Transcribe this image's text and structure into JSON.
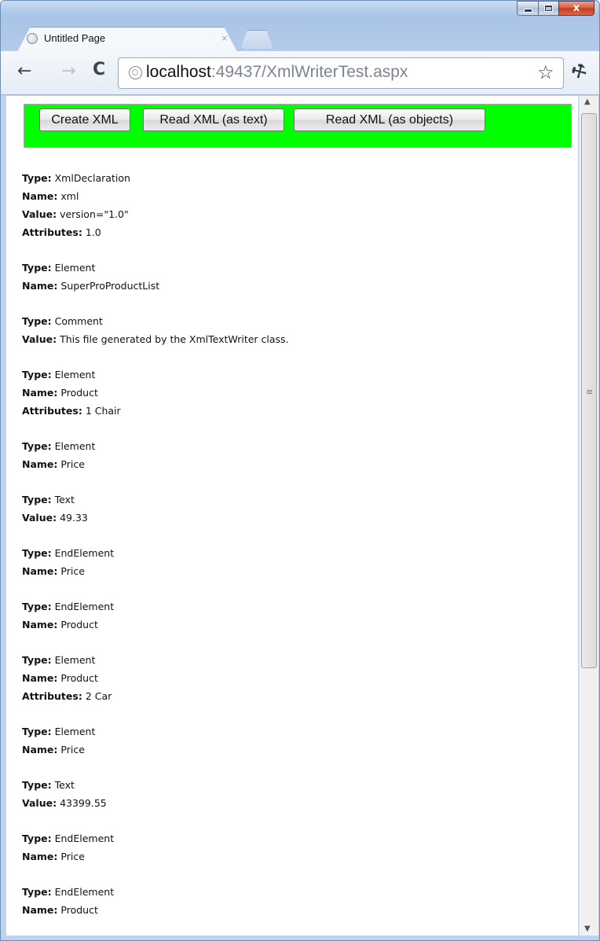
{
  "window": {
    "caption": {
      "minimize": "–",
      "maximize": "□",
      "close": "x"
    }
  },
  "tab": {
    "title": "Untitled Page",
    "close": "×"
  },
  "toolbar": {
    "back": "←",
    "forward": "→",
    "reload": "C",
    "url_host": "localhost",
    "url_rest": ":49437/XmlWriterTest.aspx",
    "star": "☆",
    "wrench": "🔧"
  },
  "buttons": {
    "create": "Create XML",
    "read_text": "Read XML (as text)",
    "read_objects": "Read XML (as objects)"
  },
  "labels": {
    "type": "Type:",
    "name": "Name:",
    "value": "Value:",
    "attributes": "Attributes:"
  },
  "nodes": [
    {
      "type": "XmlDeclaration",
      "name": "xml",
      "value": "version=\"1.0\"",
      "attributes": "1.0"
    },
    {
      "type": "Element",
      "name": "SuperProProductList"
    },
    {
      "type": "Comment",
      "value": "This file generated by the XmlTextWriter class."
    },
    {
      "type": "Element",
      "name": "Product",
      "attributes": "1 Chair"
    },
    {
      "type": "Element",
      "name": "Price"
    },
    {
      "type": "Text",
      "value": "49.33"
    },
    {
      "type": "EndElement",
      "name": "Price"
    },
    {
      "type": "EndElement",
      "name": "Product"
    },
    {
      "type": "Element",
      "name": "Product",
      "attributes": "2 Car"
    },
    {
      "type": "Element",
      "name": "Price"
    },
    {
      "type": "Text",
      "value": "43399.55"
    },
    {
      "type": "EndElement",
      "name": "Price"
    },
    {
      "type": "EndElement",
      "name": "Product"
    }
  ],
  "scrollbar": {
    "up": "▲",
    "down": "▼",
    "grip": "≡"
  }
}
